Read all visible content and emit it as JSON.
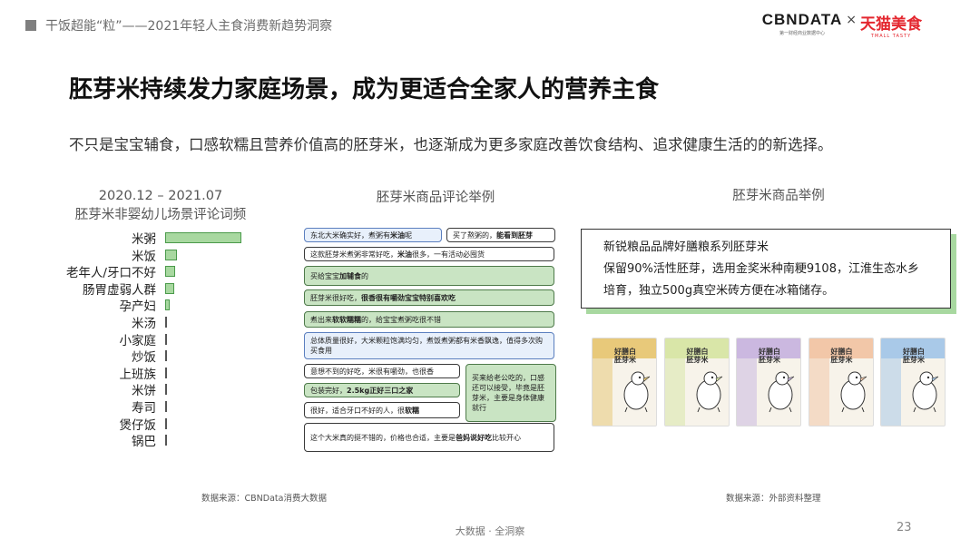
{
  "header": {
    "title": "干饭超能“粒”——2021年轻人主食消费新趋势洞察",
    "logo_cbn": "CBNDATA",
    "logo_cbn_sub": "第一财经商业数据中心",
    "logo_x": "×",
    "logo_tmall": "天猫美食",
    "logo_tmall_sub": "TMALL TASTY"
  },
  "headline": "胚芽米持续发力家庭场景，成为更适合全家人的营养主食",
  "subheadline": "不只是宝宝辅食，口感软糯且营养价值高的胚芽米，也逐渐成为更多家庭改善饮食结构、追求健康生活的的新选择。",
  "chart_section": {
    "title_line1": "2020.12 – 2021.07",
    "title_line2": "胚芽米非婴幼儿场景评论词频"
  },
  "chart_data": {
    "type": "bar",
    "orientation": "horizontal",
    "title": "2020.12 – 2021.07 胚芽米非婴幼儿场景评论词频",
    "categories": [
      "米粥",
      "米饭",
      "老年人/牙口不好",
      "肠胃虚弱人群",
      "孕产妇",
      "米汤",
      "小家庭",
      "炒饭",
      "上班族",
      "米饼",
      "寿司",
      "煲仔饭",
      "锅巴"
    ],
    "values": [
      100,
      15,
      13,
      12,
      6,
      2,
      2,
      2,
      2,
      2,
      2,
      2,
      2
    ],
    "xlim": [
      0,
      100
    ],
    "grid": false,
    "colors": {
      "fill": "#a8d8a0",
      "stroke": "#4a9a4a"
    }
  },
  "reviews_section": {
    "title": "胚芽米商品评论举例",
    "bubbles": [
      {
        "pre": "东北大米确实好，煮粥有",
        "bold": "米油",
        "post": "呢"
      },
      {
        "pre": "买了熬粥的，",
        "bold": "能看到胚芽",
        "post": ""
      },
      {
        "pre": "这款胚芽米煮粥非常好吃，",
        "bold": "米油",
        "post": "很多，一有活动必囤货"
      },
      {
        "pre": "买给宝宝",
        "bold": "加辅食",
        "post": "的"
      },
      {
        "pre": "胚芽米很好吃，",
        "bold": "很香很有嚼劲宝宝特别喜欢吃",
        "post": ""
      },
      {
        "pre": "煮出来",
        "bold": "软软糯糯",
        "post": "的，给宝宝煮粥吃很不错"
      },
      {
        "pre": "总体质量很好，大米颗粒饱满均匀，煮饭煮粥都有米香飘逸，值得多次购买食用",
        "bold": "",
        "post": ""
      },
      {
        "pre": "意想不到的好吃，米很有嚼劲，也很香",
        "bold": "",
        "post": ""
      },
      {
        "pre": "买来给老公吃的，口感还可以接受，毕竟是胚芽米，主要是身体健康就行",
        "bold": "",
        "post": ""
      },
      {
        "pre": "包装完好，",
        "bold": "2.5kg正好三口之家",
        "post": ""
      },
      {
        "pre": "很好，适合牙口不好的人，很",
        "bold": "软糯",
        "post": ""
      },
      {
        "pre": "这个大米真的挺不错的，价格也合适，主要是",
        "bold": "爸妈说好吃",
        "post": "比较开心"
      }
    ]
  },
  "products_section": {
    "title": "胚芽米商品举例",
    "info_line1": "新锐粮品品牌好膳粮系列胚芽米",
    "info_line2": "保留90%活性胚芽，选用金奖米种南粳9108，江淮生态水乡",
    "info_line3": "培育，独立500g真空米砖方便在冰箱储存。",
    "box_title": "好膳白胚芽米",
    "box_colors": [
      "#e8c97a",
      "#d9e6a8",
      "#cbb8e0",
      "#f2c7a8",
      "#a9c9e8"
    ]
  },
  "sources": {
    "left": "数据来源：CBNData消费大数据",
    "right": "数据来源：外部资料整理"
  },
  "footer": {
    "center": "大数据 · 全洞察",
    "page": "23"
  }
}
